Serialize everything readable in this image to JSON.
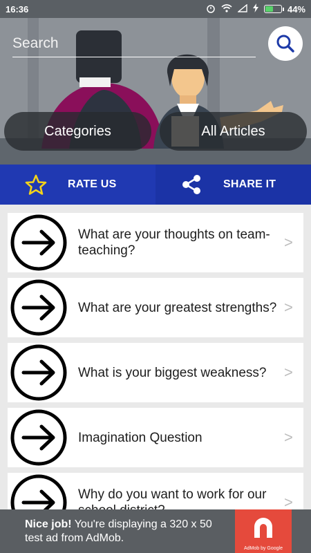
{
  "status_bar": {
    "time": "16:36",
    "battery": "44%"
  },
  "search": {
    "placeholder": "Search"
  },
  "tabs": [
    {
      "label": "Categories"
    },
    {
      "label": "All Articles"
    }
  ],
  "actions": {
    "rate_label": "RATE US",
    "share_label": "SHARE IT"
  },
  "questions": [
    {
      "text": "What are your thoughts on team-teaching?"
    },
    {
      "text": "What are your greatest strengths?"
    },
    {
      "text": "What is your biggest weakness?"
    },
    {
      "text": "Imagination Question"
    },
    {
      "text": "Why do you want to work for our school district?"
    }
  ],
  "chevron": ">",
  "ad": {
    "bold": "Nice job!",
    "text": " You're displaying a 320 x 50 test ad from AdMob.",
    "caption": "AdMob by Google"
  },
  "colors": {
    "rate_bg": "#2039b2",
    "share_bg": "#1b33a6",
    "star": "#f2d21b",
    "ad_logo": "#e54a3c"
  }
}
